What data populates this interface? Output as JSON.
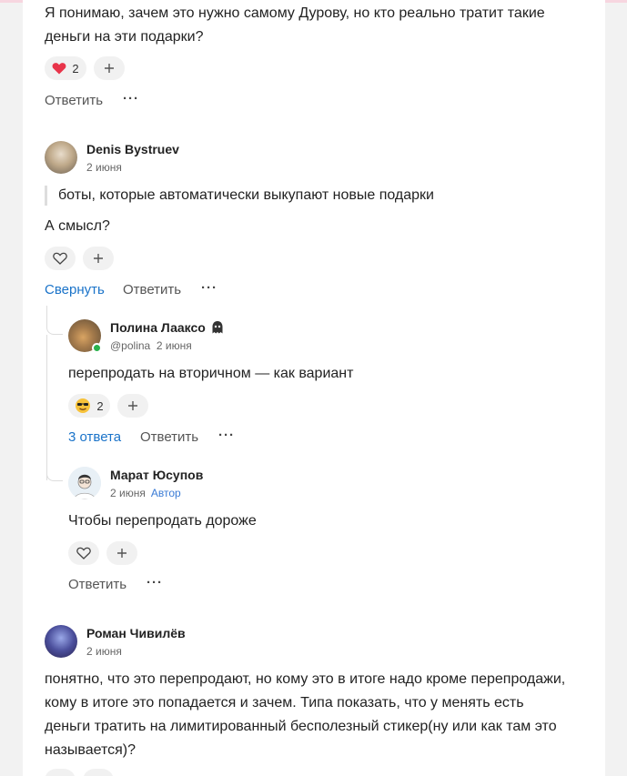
{
  "top_comment": {
    "text": "Я понимаю, зачем это нужно самому Дурову, но кто реально тратит такие деньги на эти подарки?",
    "reaction_count": "2",
    "reply_label": "Ответить"
  },
  "comment_denis": {
    "author": "Denis Bystruev",
    "date": "2 июня",
    "quote": "боты, которые автоматически выкупают новые подарки",
    "text": "А смысл?",
    "collapse_label": "Свернуть",
    "reply_label": "Ответить"
  },
  "reply_polina": {
    "author": "Полина Лааксо",
    "handle": "@polina",
    "date": "2 июня",
    "text": "перепродать на вторичном — как вариант",
    "reaction_count": "2",
    "answers_label": "3 ответа",
    "reply_label": "Ответить"
  },
  "reply_marat": {
    "author": "Марат Юсупов",
    "date": "2 июня",
    "author_badge": "Автор",
    "text": "Чтобы перепродать дороже",
    "reply_label": "Ответить"
  },
  "comment_roman": {
    "author": "Роман Чивилёв",
    "date": "2 июня",
    "text": "понятно, что это перепродают, но кому это в итоге надо кроме перепродажи, кому в итоге это попадается и зачем. Типа показать, что у менять есть деньги тратить на лимитированный бесполезный стикер(ну или как там это называется)?"
  },
  "colors": {
    "accent_blue": "#1a73c9",
    "heart_red": "#e8344a",
    "online_green": "#2ab24d"
  },
  "icons": {
    "heart_filled": "heart-icon",
    "heart_outline": "heart-outline-icon",
    "plus": "plus-icon",
    "more": "more-dots-icon",
    "emoji_cool": "sunglasses-emoji-icon",
    "ghost": "ghost-icon"
  }
}
